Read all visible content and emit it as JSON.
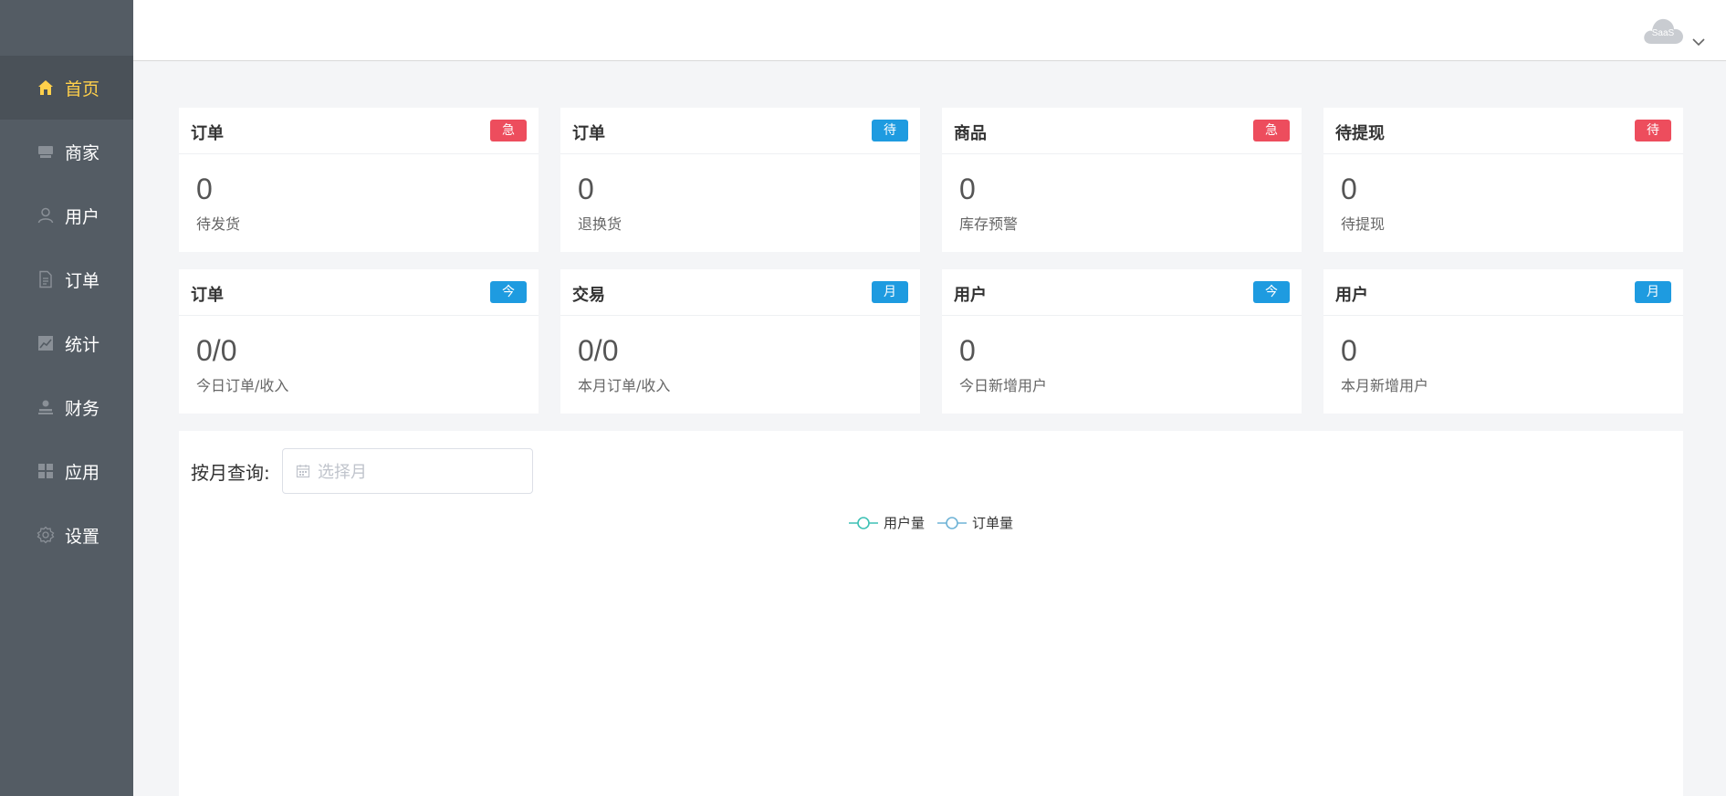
{
  "sidebar": {
    "items": [
      {
        "label": "首页",
        "icon": "home-icon",
        "active": true
      },
      {
        "label": "商家",
        "icon": "store-icon",
        "active": false
      },
      {
        "label": "用户",
        "icon": "user-icon",
        "active": false
      },
      {
        "label": "订单",
        "icon": "document-icon",
        "active": false
      },
      {
        "label": "统计",
        "icon": "chart-icon",
        "active": false
      },
      {
        "label": "财务",
        "icon": "finance-icon",
        "active": false
      },
      {
        "label": "应用",
        "icon": "grid-icon",
        "active": false
      },
      {
        "label": "设置",
        "icon": "gear-icon",
        "active": false
      }
    ],
    "background": "#545c64",
    "active_color": "#ffd04b"
  },
  "header": {
    "avatar_label": "SaaS"
  },
  "cards": [
    {
      "title": "订单",
      "badge": "急",
      "badge_color": "#ed4d5d",
      "value": "0",
      "label": "待发货"
    },
    {
      "title": "订单",
      "badge": "待",
      "badge_color": "#1e9be0",
      "value": "0",
      "label": "退换货"
    },
    {
      "title": "商品",
      "badge": "急",
      "badge_color": "#ed4d5d",
      "value": "0",
      "label": "库存预警"
    },
    {
      "title": "待提现",
      "badge": "待",
      "badge_color": "#ed4d5d",
      "value": "0",
      "label": "待提现"
    },
    {
      "title": "订单",
      "badge": "今",
      "badge_color": "#1e9be0",
      "value": "0/0",
      "label": "今日订单/收入"
    },
    {
      "title": "交易",
      "badge": "月",
      "badge_color": "#1e9be0",
      "value": "0/0",
      "label": "本月订单/收入"
    },
    {
      "title": "用户",
      "badge": "今",
      "badge_color": "#1e9be0",
      "value": "0",
      "label": "今日新增用户"
    },
    {
      "title": "用户",
      "badge": "月",
      "badge_color": "#1e9be0",
      "value": "0",
      "label": "本月新增用户"
    }
  ],
  "query": {
    "label": "按月查询:",
    "placeholder": "选择月"
  },
  "chart_data": {
    "type": "line",
    "series": [
      {
        "name": "用户量",
        "color": "#3ec1b5",
        "values": []
      },
      {
        "name": "订单量",
        "color": "#6fb3d6",
        "values": []
      }
    ],
    "legend": "top-center"
  }
}
